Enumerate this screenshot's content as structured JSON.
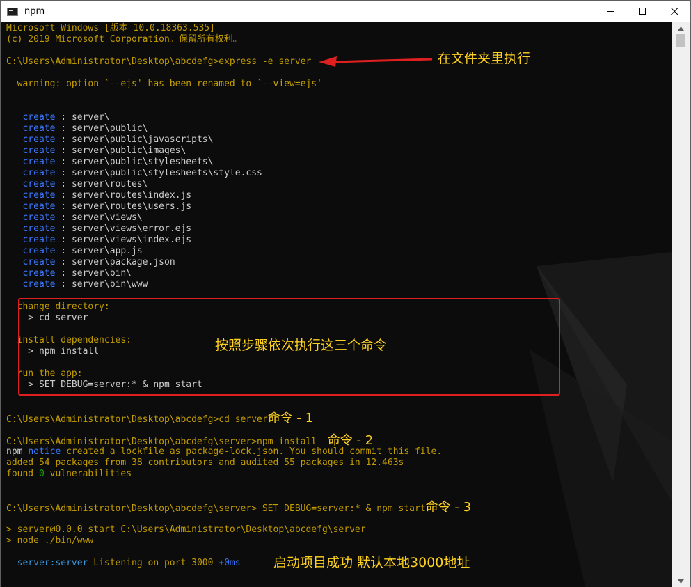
{
  "window": {
    "title": "npm",
    "icon": "cmd-icon",
    "controls": [
      "minimize-icon",
      "maximize-icon",
      "close-icon"
    ]
  },
  "terminal": {
    "header1": "Microsoft Windows [版本 10.0.18363.535]",
    "header2": "(c) 2019 Microsoft Corporation。保留所有权利。",
    "cmd1": "C:\\Users\\Administrator\\Desktop\\abcdefg>express -e server",
    "warning": "  warning: option `--ejs' has been renamed to `--view=ejs'",
    "create_label": "create",
    "create_sep": " : ",
    "create_paths": [
      "server\\",
      "server\\public\\",
      "server\\public\\javascripts\\",
      "server\\public\\images\\",
      "server\\public\\stylesheets\\",
      "server\\public\\stylesheets\\style.css",
      "server\\routes\\",
      "server\\routes\\index.js",
      "server\\routes\\users.js",
      "server\\views\\",
      "server\\views\\error.ejs",
      "server\\views\\index.ejs",
      "server\\app.js",
      "server\\package.json",
      "server\\bin\\",
      "server\\bin\\www"
    ],
    "change_dir": "  change directory:",
    "cd_cmd": "    > cd server",
    "install_deps": "  install dependencies:",
    "npm_install_cmd": "    > npm install",
    "run_app": "  run the app:",
    "run_cmd": "    > SET DEBUG=server:* & npm start",
    "cmd2": "C:\\Users\\Administrator\\Desktop\\abcdefg>cd server",
    "cmd3": "C:\\Users\\Administrator\\Desktop\\abcdefg\\server>npm install ",
    "npm_word": "npm",
    "notice_word": "notice",
    "notice_text": " created a lockfile as package-lock.json. You should commit this file.",
    "added": "added 54 packages from 38 contributors and audited 55 packages in 12.463s",
    "found_pre": "found ",
    "found_zero": "0",
    "found_post": " vulnerabilities",
    "cmd4": "C:\\Users\\Administrator\\Desktop\\abcdefg\\server> SET DEBUG=server:* & npm start",
    "start_line": "> server@0.0.0 start C:\\Users\\Administrator\\Desktop\\abcdefg\\server",
    "node_line": "> node ./bin/www",
    "listen_name": "server:server",
    "listen_text": " Listening on port 3000 ",
    "listen_time": "+0ms"
  },
  "annotations": {
    "folder_exec": "在文件夹里执行",
    "steps": "按照步骤依次执行这三个命令",
    "cmd_1": "命令 - 1",
    "cmd_2": "命令 - 2",
    "cmd_3": "命令 - 3",
    "success": "启动项目成功  默认本地3000地址"
  },
  "colors": {
    "background": "#0c0c0c",
    "yellow_text": "#c19c00",
    "grey_text": "#cccccc",
    "blue_text": "#3b78ff",
    "annotation": "#ffd21f",
    "highlight_box": "#e02020"
  }
}
